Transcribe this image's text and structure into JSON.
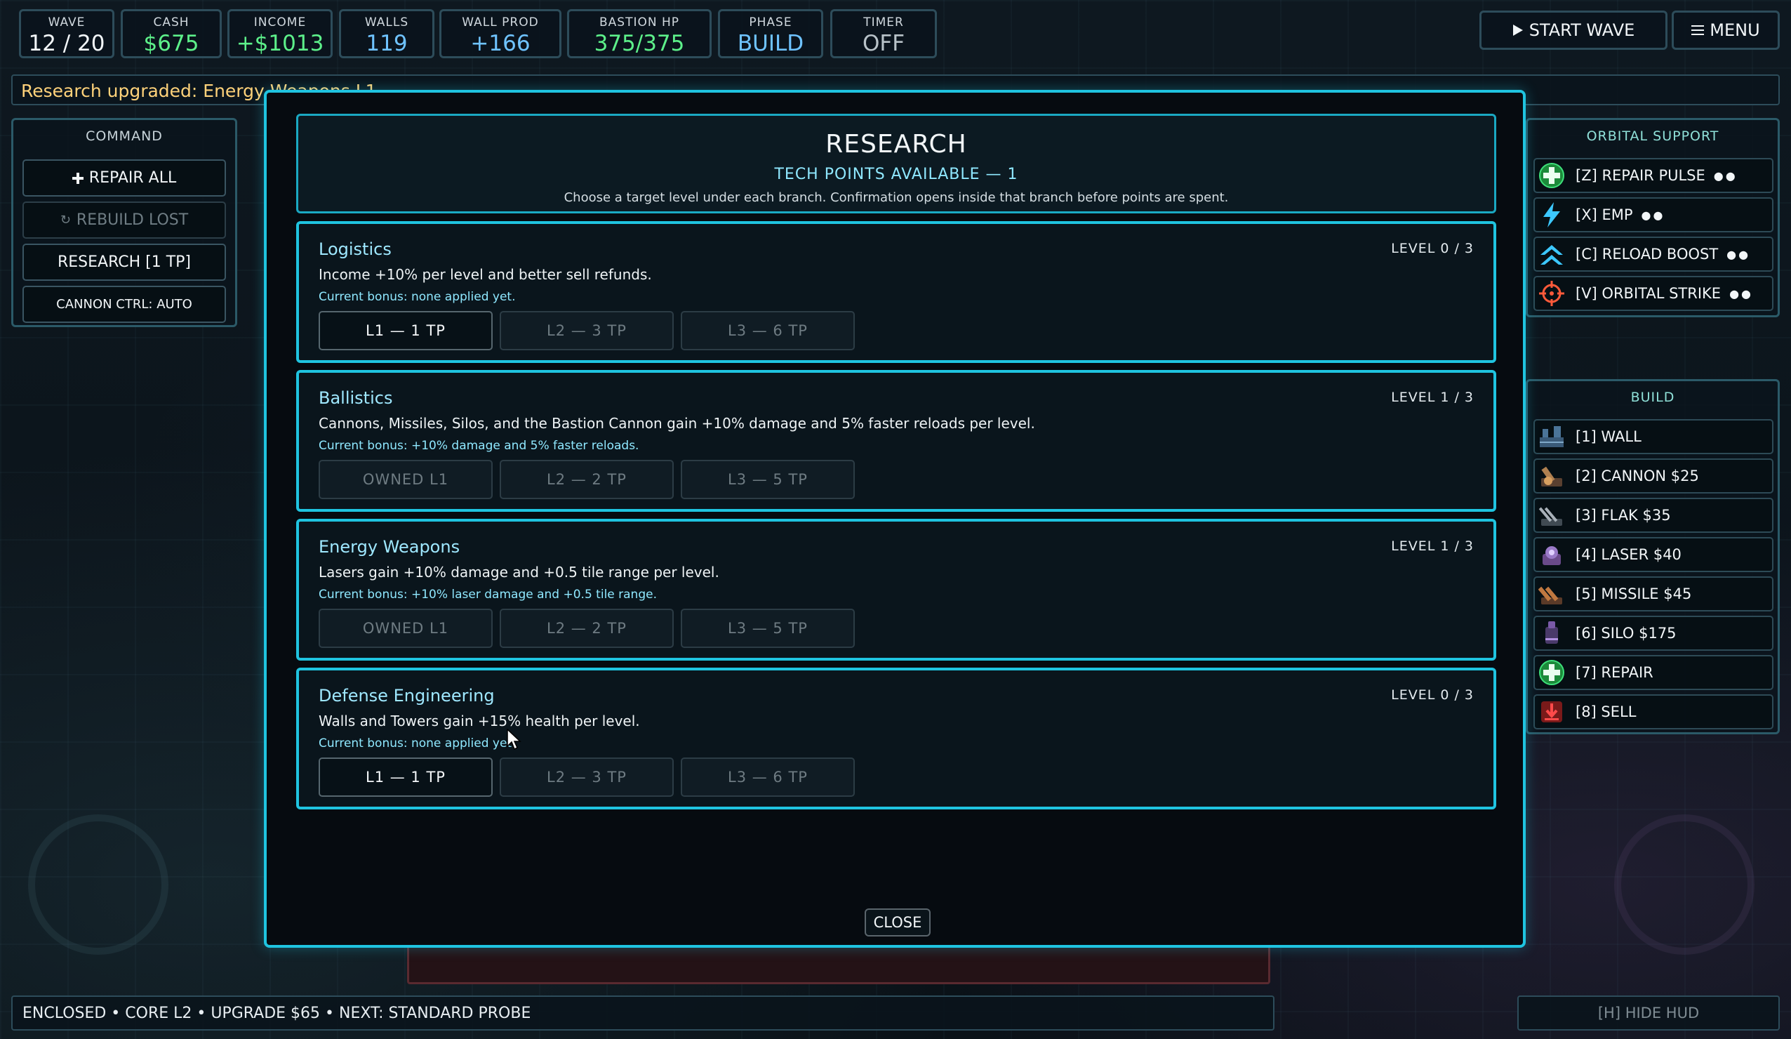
{
  "stats": [
    {
      "label": "WAVE",
      "value": "12 / 20",
      "color": "#f2f6f8"
    },
    {
      "label": "CASH",
      "value": "$675",
      "color": "#5df08a"
    },
    {
      "label": "INCOME",
      "value": "+$1013",
      "color": "#5df08a"
    },
    {
      "label": "WALLS",
      "value": "119",
      "color": "#6fc3ff"
    },
    {
      "label": "WALL PROD",
      "value": "+166",
      "color": "#6fc3ff"
    },
    {
      "label": "BASTION HP",
      "value": "375/375",
      "color": "#5df08a"
    },
    {
      "label": "PHASE",
      "value": "BUILD",
      "color": "#6fc3ff"
    },
    {
      "label": "TIMER",
      "value": "OFF",
      "color": "#b8c2c8"
    }
  ],
  "top_buttons": {
    "start_wave": "START WAVE",
    "menu": "MENU",
    "start_icon": "play-icon",
    "menu_icon": "hamburger-icon"
  },
  "notification": "Research upgraded: Energy Weapons L1",
  "command": {
    "title": "COMMAND",
    "repair_all": "REPAIR ALL",
    "rebuild_lost": "REBUILD LOST",
    "research": "RESEARCH [1 TP]",
    "cannon_ctrl": "CANNON CTRL: AUTO"
  },
  "orbital": {
    "title": "ORBITAL SUPPORT",
    "items": [
      {
        "label": "[Z] REPAIR PULSE",
        "charges": "●●",
        "icon": "repair-pulse-icon"
      },
      {
        "label": "[X] EMP",
        "charges": "●●",
        "icon": "emp-lightning-icon"
      },
      {
        "label": "[C] RELOAD BOOST",
        "charges": "●●",
        "icon": "reload-boost-icon"
      },
      {
        "label": "[V] ORBITAL STRIKE",
        "charges": "●●",
        "icon": "crosshair-icon"
      }
    ]
  },
  "build": {
    "title": "BUILD",
    "items": [
      {
        "label": "[1] WALL",
        "icon": "wall-icon"
      },
      {
        "label": "[2] CANNON $25",
        "icon": "cannon-icon"
      },
      {
        "label": "[3] FLAK $35",
        "icon": "flak-icon"
      },
      {
        "label": "[4] LASER $40",
        "icon": "laser-icon"
      },
      {
        "label": "[5] MISSILE $45",
        "icon": "missile-icon"
      },
      {
        "label": "[6] SILO $175",
        "icon": "silo-icon"
      },
      {
        "label": "[7] REPAIR",
        "icon": "repair-icon"
      },
      {
        "label": "[8] SELL",
        "icon": "sell-icon"
      }
    ]
  },
  "research": {
    "title": "RESEARCH",
    "tech_points": "TECH POINTS AVAILABLE — 1",
    "instructions": "Choose a target level under each branch. Confirmation opens inside that branch before points are spent.",
    "branches": [
      {
        "name": "Logistics",
        "level": "LEVEL 0 / 3",
        "description": "Income +10% per level and better sell refunds.",
        "bonus": "Current bonus: none applied yet.",
        "buttons": [
          {
            "label": "L1 — 1 TP",
            "state": "active"
          },
          {
            "label": "L2 — 3 TP",
            "state": "locked"
          },
          {
            "label": "L3 — 6 TP",
            "state": "locked"
          }
        ]
      },
      {
        "name": "Ballistics",
        "level": "LEVEL 1 / 3",
        "description": "Cannons, Missiles, Silos, and the Bastion Cannon gain +10% damage and 5% faster reloads per level.",
        "bonus": "Current bonus: +10% damage and 5% faster reloads.",
        "buttons": [
          {
            "label": "OWNED L1",
            "state": "owned"
          },
          {
            "label": "L2 — 2 TP",
            "state": "locked"
          },
          {
            "label": "L3 — 5 TP",
            "state": "locked"
          }
        ]
      },
      {
        "name": "Energy Weapons",
        "level": "LEVEL 1 / 3",
        "description": "Lasers gain +10% damage and +0.5 tile range per level.",
        "bonus": "Current bonus: +10% laser damage and +0.5 tile range.",
        "buttons": [
          {
            "label": "OWNED L1",
            "state": "owned"
          },
          {
            "label": "L2 — 2 TP",
            "state": "locked"
          },
          {
            "label": "L3 — 5 TP",
            "state": "locked"
          }
        ]
      },
      {
        "name": "Defense Engineering",
        "level": "LEVEL 0 / 3",
        "description": "Walls and Towers gain +15% health per level.",
        "bonus": "Current bonus: none applied yet.",
        "buttons": [
          {
            "label": "L1 — 1 TP",
            "state": "active"
          },
          {
            "label": "L2 — 3 TP",
            "state": "locked"
          },
          {
            "label": "L3 — 6 TP",
            "state": "locked"
          }
        ]
      }
    ],
    "close": "CLOSE"
  },
  "status_bar": "ENCLOSED • CORE L2 • UPGRADE $65 • NEXT: STANDARD PROBE",
  "hide_hud": "[H] HIDE HUD"
}
